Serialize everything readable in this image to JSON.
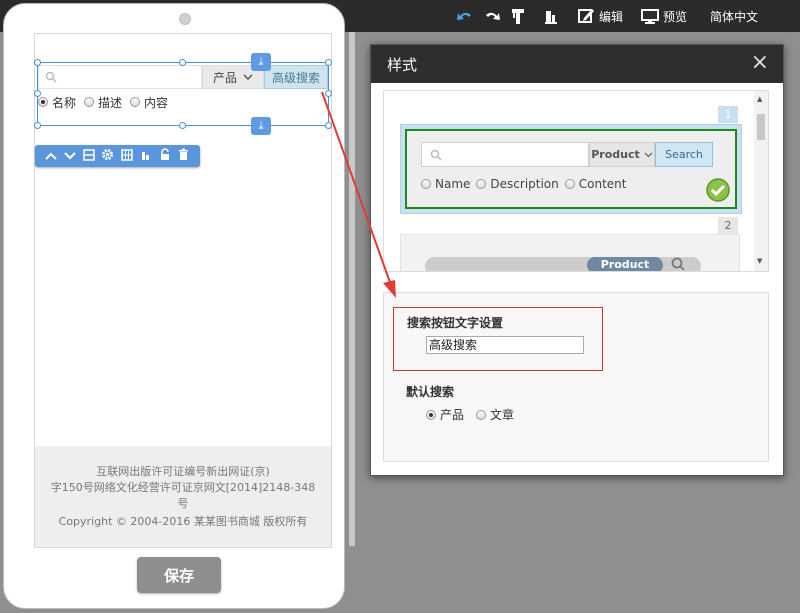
{
  "colors": {
    "accent_blue": "#5b95dc",
    "toolbar_bg": "#2b2b2b",
    "highlight_red": "#c0392b",
    "selected_green": "#1a8c1a"
  },
  "toolbar": {
    "edit_label": "编辑",
    "preview_label": "预览",
    "language_label": "简体中文",
    "icons": [
      "undo-icon",
      "redo-icon",
      "tools-icon",
      "chart-icon",
      "edit-icon",
      "monitor-icon"
    ]
  },
  "widget": {
    "category_label": "产品",
    "search_button_label": "高级搜索",
    "radios": [
      {
        "label": "名称",
        "checked": true
      },
      {
        "label": "描述",
        "checked": false
      },
      {
        "label": "内容",
        "checked": false
      }
    ]
  },
  "footer": {
    "line1": "互联网出版许可证编号新出网证(京)",
    "line2": "字150号网络文化经营许可证京网文[2014]2148-348",
    "line3": "号",
    "line4": "Copyright © 2004-2016 某某图书商城 版权所有"
  },
  "save_label": "保存",
  "dialog": {
    "title": "样式",
    "close_glyph": "×",
    "preview1": {
      "number": "1",
      "category_label": "Product",
      "search_button_label": "Search",
      "radios": [
        {
          "label": "Name",
          "checked": false
        },
        {
          "label": "Description",
          "checked": false
        },
        {
          "label": "Content",
          "checked": false
        }
      ]
    },
    "preview2": {
      "number": "2",
      "category_label": "Product"
    },
    "settings": {
      "button_text_label": "搜索按钮文字设置",
      "button_text_value": "高级搜索",
      "default_search_label": "默认搜索",
      "default_options": [
        {
          "label": "产品",
          "checked": true
        },
        {
          "label": "文章",
          "checked": false
        }
      ]
    }
  }
}
